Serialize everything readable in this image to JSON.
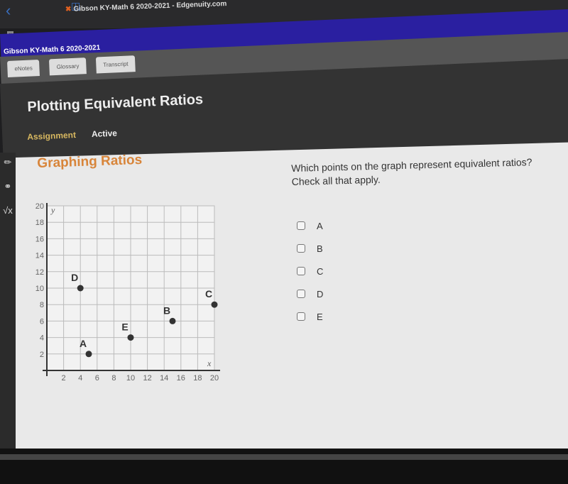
{
  "browser": {
    "tab_title": "Gibson KY-Math 6 2020-2021 - Edgenuity.com"
  },
  "course": {
    "name": "Gibson KY-Math 6 2020-2021"
  },
  "tabs": [
    {
      "label": "eNotes"
    },
    {
      "label": "Glossary"
    },
    {
      "label": "Transcript"
    }
  ],
  "lesson": {
    "title": "Plotting Equivalent Ratios",
    "type": "Assignment",
    "status": "Active"
  },
  "section_title": "Graphing Ratios",
  "question": {
    "line1": "Which points on the graph represent equivalent ratios?",
    "line2": "Check all that apply."
  },
  "options": [
    {
      "label": "A",
      "checked": false
    },
    {
      "label": "B",
      "checked": false
    },
    {
      "label": "C",
      "checked": false
    },
    {
      "label": "D",
      "checked": false
    },
    {
      "label": "E",
      "checked": false
    }
  ],
  "chart_data": {
    "type": "scatter",
    "xlabel": "x",
    "ylabel": "y",
    "xlim": [
      0,
      20
    ],
    "ylim": [
      0,
      20
    ],
    "grid": true,
    "xticks": [
      2,
      4,
      6,
      8,
      10,
      12,
      14,
      16,
      18,
      20
    ],
    "yticks": [
      2,
      4,
      6,
      8,
      10,
      12,
      14,
      16,
      18,
      20
    ],
    "points": [
      {
        "label": "A",
        "x": 5,
        "y": 2
      },
      {
        "label": "B",
        "x": 15,
        "y": 6
      },
      {
        "label": "C",
        "x": 20,
        "y": 8
      },
      {
        "label": "D",
        "x": 4,
        "y": 10
      },
      {
        "label": "E",
        "x": 10,
        "y": 4
      }
    ]
  }
}
